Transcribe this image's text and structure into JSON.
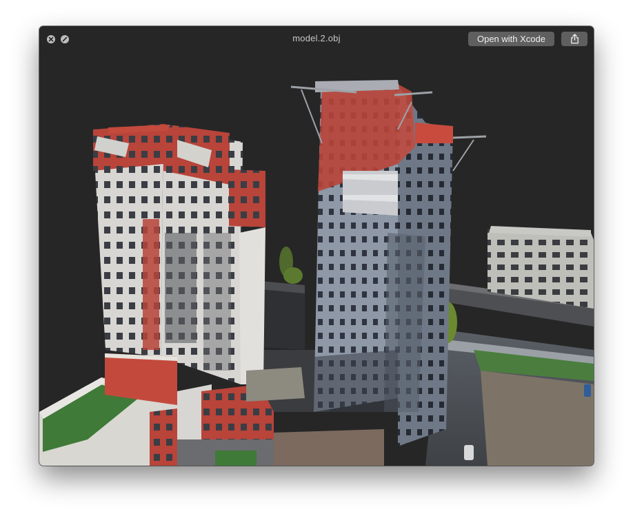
{
  "window": {
    "title": "model.2.obj",
    "open_button_label": "Open with Xcode",
    "close_icon": "close-icon",
    "fullscreen_icon": "fullscreen-icon",
    "share_icon": "share-icon"
  },
  "viewer": {
    "background": "#262626",
    "content": "3D model view"
  }
}
